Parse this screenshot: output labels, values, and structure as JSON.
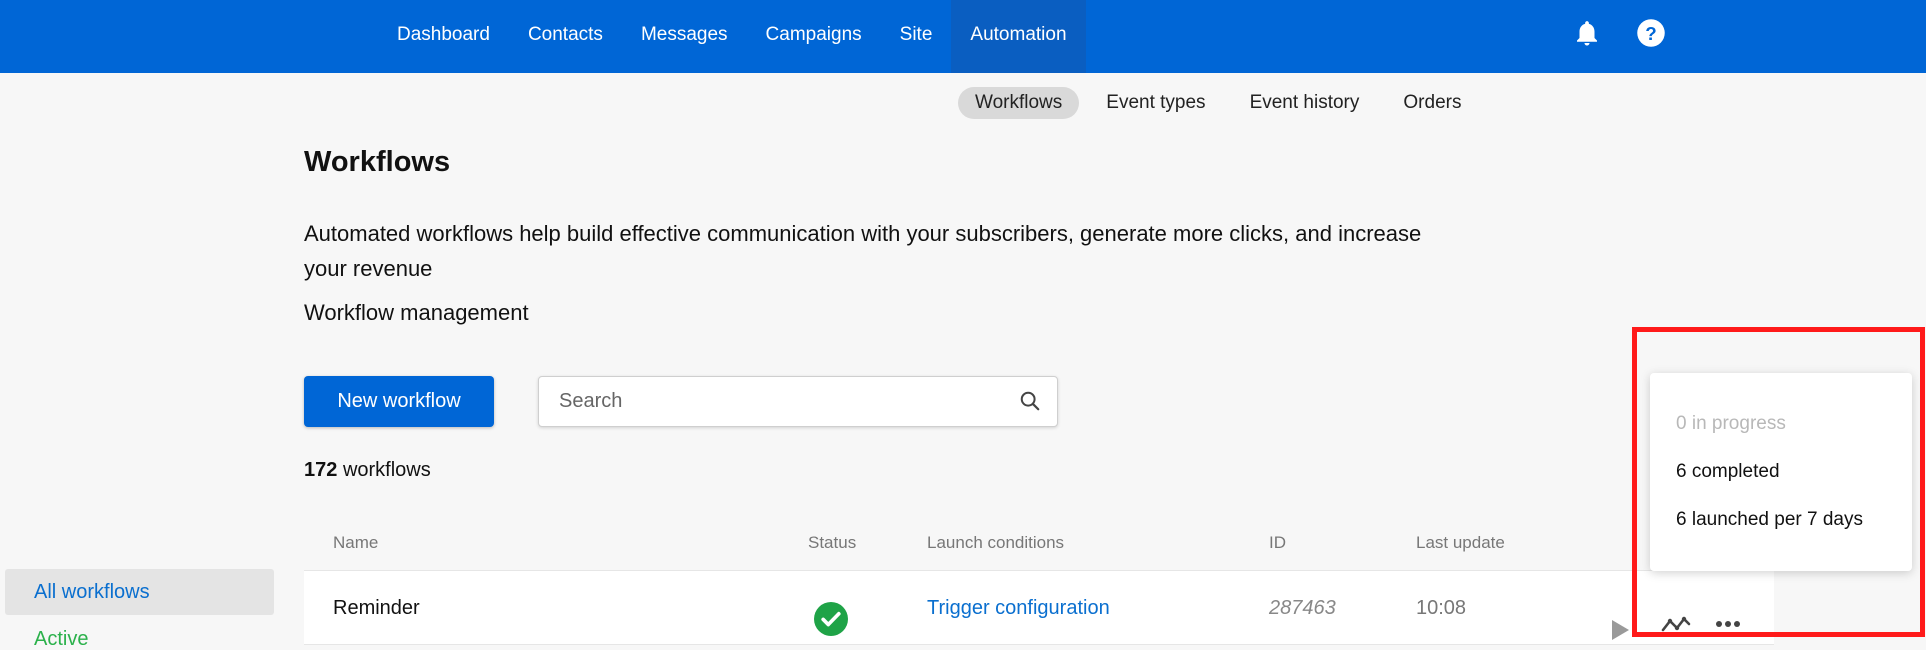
{
  "topnav": {
    "items": [
      {
        "label": "Dashboard"
      },
      {
        "label": "Contacts"
      },
      {
        "label": "Messages"
      },
      {
        "label": "Campaigns"
      },
      {
        "label": "Site"
      },
      {
        "label": "Automation",
        "active": true
      }
    ],
    "icons": [
      "bell-icon",
      "help-icon"
    ],
    "color": "#0066d6"
  },
  "subnav": {
    "items": [
      {
        "label": "Workflows",
        "active": true
      },
      {
        "label": "Event types"
      },
      {
        "label": "Event history"
      },
      {
        "label": "Orders"
      }
    ]
  },
  "page": {
    "title": "Workflows",
    "description": "Automated workflows help build effective communication with your subscribers, generate more clicks, and increase your revenue",
    "management_label": "Workflow management"
  },
  "toolbar": {
    "new_button": "New workflow",
    "search_placeholder": "Search"
  },
  "summary": {
    "count": "172",
    "count_label": "workflows"
  },
  "sidebar": {
    "items": [
      {
        "label": "All workflows",
        "selected": true
      },
      {
        "label": "Active",
        "color": "#2bb14b"
      }
    ]
  },
  "table": {
    "columns": [
      "Name",
      "Status",
      "Launch conditions",
      "ID",
      "Last update"
    ],
    "rows": [
      {
        "name": "Reminder",
        "status": "check-circle-icon",
        "launch": "Trigger configuration",
        "id": "287463",
        "updated": "10:08"
      }
    ]
  },
  "popup": {
    "in_progress": "0 in progress",
    "completed": "6 completed",
    "launched": "6 launched per 7 days"
  },
  "highlight_color": "#ff1a1a"
}
